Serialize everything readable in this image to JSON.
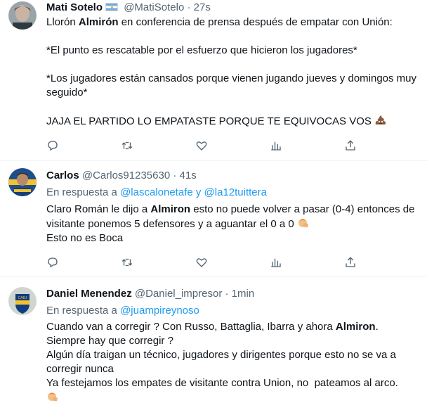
{
  "tweets": [
    {
      "name": "Mati Sotelo",
      "handle": "@MatiSotelo",
      "dot": "·",
      "time": "27s",
      "lines": [
        {
          "pre": "Llorón ",
          "bold": "Almirón",
          "post": " en conferencia de prensa después de empatar con Unión:"
        },
        {
          "pre": "",
          "bold": "",
          "post": ""
        },
        {
          "pre": "*El punto es rescatable por el esfuerzo que hicieron los jugadores*",
          "bold": "",
          "post": ""
        },
        {
          "pre": "",
          "bold": "",
          "post": ""
        },
        {
          "pre": "*Los jugadores están cansados porque vienen jugando jueves y domingos muy seguido*",
          "bold": "",
          "post": ""
        },
        {
          "pre": "",
          "bold": "",
          "post": ""
        },
        {
          "pre": "JAJA EL PARTIDO LO EMPATASTE PORQUE TE EQUIVOCAS VOS ",
          "bold": "",
          "post": ""
        }
      ],
      "emoji": "poop-emoji"
    },
    {
      "name": "Carlos",
      "handle": "@Carlos91235630",
      "dot": "·",
      "time": "41s",
      "reply_prefix": "En respuesta a ",
      "reply_mentions": [
        "@lascalonetafe",
        "@la12tuittera"
      ],
      "reply_joiner": " y ",
      "lines": [
        {
          "pre": "Claro Román le dijo a ",
          "bold": "Almiron",
          "post": " esto no puede volver a pasar (0-4) entonces de visitante ponemos 5 defensores y a aguantar el 0 a 0 "
        },
        {
          "pre": "Esto no es Boca",
          "bold": "",
          "post": ""
        }
      ],
      "emoji": "facepalm-emoji"
    },
    {
      "name": "Daniel Menendez",
      "handle": "@Daniel_impresor",
      "dot": "·",
      "time": "1min",
      "reply_prefix": "En respuesta a ",
      "reply_mentions": [
        "@juampireynoso"
      ],
      "lines": [
        {
          "pre": "Cuando van a corregir ? Con Russo, Battaglia, Ibarra y ahora ",
          "bold": "Almiron",
          "post": "."
        },
        {
          "pre": "Siempre hay que corregir ?",
          "bold": "",
          "post": ""
        },
        {
          "pre": "Algún día traigan un técnico, jugadores y dirigentes porque esto no se va a corregir nunca",
          "bold": "",
          "post": ""
        },
        {
          "pre": "Ya festejamos los empates de visitante contra Union, no  pateamos al arco.",
          "bold": "",
          "post": ""
        }
      ],
      "emoji": "facepalm-emoji"
    }
  ],
  "colors": {
    "accent": "#1d9bf0",
    "muted": "#536471",
    "text": "#0f1419"
  },
  "action_icons": [
    "reply-icon",
    "retweet-icon",
    "like-icon",
    "views-icon",
    "share-icon"
  ]
}
